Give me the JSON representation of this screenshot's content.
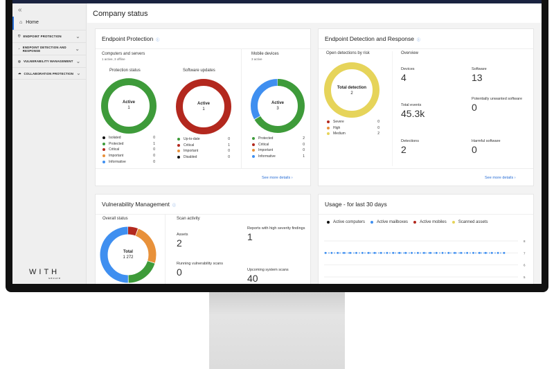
{
  "sidebar": {
    "collapse_icon": "double-chevron-left",
    "home": "Home",
    "items": [
      {
        "label": "ENDPOINT PROTECTION",
        "icon": "shield-icon"
      },
      {
        "label": "ENDPOINT DETECTION AND RESPONSE",
        "icon": "radar-icon"
      },
      {
        "label": "VULNERABILITY MANAGEMENT",
        "icon": "scan-icon"
      },
      {
        "label": "COLLABORATION PROTECTION",
        "icon": "cloud-icon"
      }
    ],
    "logo": "WITH",
    "logo_sub": "secure"
  },
  "header": {
    "title": "Company status"
  },
  "colors": {
    "green": "#3e9b3a",
    "red": "#b3281e",
    "orange": "#e8913a",
    "blue": "#3f8ff0",
    "yellow": "#e6d45a",
    "black": "#111111"
  },
  "endpoint": {
    "title": "Endpoint Protection",
    "computers_title": "Computers and servers",
    "computers_sub": "1 active, 3 offline",
    "protection": {
      "title": "Protection status",
      "center_label": "Active",
      "center_value": "1",
      "items": [
        {
          "label": "Isolated",
          "value": 0,
          "color": "#111111"
        },
        {
          "label": "Protected",
          "value": 1,
          "color": "#3e9b3a"
        },
        {
          "label": "Critical",
          "value": 0,
          "color": "#b3281e"
        },
        {
          "label": "Important",
          "value": 0,
          "color": "#e8913a"
        },
        {
          "label": "Informative",
          "value": 0,
          "color": "#3f8ff0"
        }
      ]
    },
    "updates": {
      "title": "Software updates",
      "center_label": "Active",
      "center_value": "1",
      "items": [
        {
          "label": "Up-to-date",
          "value": 0,
          "color": "#3e9b3a"
        },
        {
          "label": "Critical",
          "value": 1,
          "color": "#b3281e"
        },
        {
          "label": "Important",
          "value": 0,
          "color": "#e8913a"
        },
        {
          "label": "Disabled",
          "value": 0,
          "color": "#111111"
        }
      ]
    },
    "mobile": {
      "title": "Mobile devices",
      "sub": "3 active",
      "center_label": "Active",
      "center_value": "3",
      "items": [
        {
          "label": "Protected",
          "value": 2,
          "color": "#3e9b3a"
        },
        {
          "label": "Critical",
          "value": 0,
          "color": "#b3281e"
        },
        {
          "label": "Important",
          "value": 0,
          "color": "#e8913a"
        },
        {
          "label": "Informative",
          "value": 1,
          "color": "#3f8ff0"
        }
      ]
    },
    "more": "See more details"
  },
  "edr": {
    "title": "Endpoint Detection and Response",
    "risk_title": "Open detections by risk",
    "center_label": "Total detection",
    "center_value": "2",
    "items": [
      {
        "label": "Severe",
        "value": 0,
        "color": "#b3281e"
      },
      {
        "label": "High",
        "value": 0,
        "color": "#e8913a"
      },
      {
        "label": "Medium",
        "value": 2,
        "color": "#e6d45a"
      }
    ],
    "overview_title": "Overview",
    "stats": [
      {
        "label": "Devices",
        "value": "4"
      },
      {
        "label": "Software",
        "value": "13"
      },
      {
        "label": "Total events",
        "value": "45.3k"
      },
      {
        "label": "Potentially unwanted software",
        "value": "0"
      },
      {
        "label": "Detections",
        "value": "2"
      },
      {
        "label": "Harmful software",
        "value": "0"
      }
    ],
    "more": "See more details"
  },
  "vuln": {
    "title": "Vulnerability Management",
    "overall_title": "Overall status",
    "center_label": "Total",
    "center_value": "1 272",
    "segments": [
      {
        "fraction": 0.06,
        "color": "#b3281e"
      },
      {
        "fraction": 0.24,
        "color": "#e8913a"
      },
      {
        "fraction": 0.2,
        "color": "#3e9b3a"
      },
      {
        "fraction": 0.5,
        "color": "#3f8ff0"
      }
    ],
    "scan_title": "Scan activity",
    "stats": [
      {
        "label": "Assets",
        "value": "2"
      },
      {
        "label": "Reports with high severity findings",
        "value": "1"
      },
      {
        "label": "Running vulnerability scans",
        "value": "0"
      },
      {
        "label": "Upcoming system scans",
        "value": "40"
      }
    ]
  },
  "chart_data": {
    "type": "line",
    "title": "Usage - for last 30 days",
    "legend_position": "top-left",
    "legend": [
      {
        "name": "Active computers",
        "color": "#111111"
      },
      {
        "name": "Active mailboxes",
        "color": "#3f8ff0"
      },
      {
        "name": "Active mobiles",
        "color": "#b3281e"
      },
      {
        "name": "Scanned assets",
        "color": "#e6d45a"
      }
    ],
    "yticks": [
      "8",
      "7",
      "6",
      "5"
    ],
    "ylim": [
      5,
      8
    ],
    "grid": true,
    "series": [
      {
        "name": "Active mailboxes",
        "values": [
          7,
          7,
          7,
          7,
          7,
          7,
          7,
          7,
          7,
          7,
          7,
          7,
          7,
          7,
          7,
          7,
          7,
          7,
          7,
          7,
          7,
          7,
          7,
          7,
          7,
          7,
          7,
          7,
          7,
          7
        ]
      }
    ]
  }
}
